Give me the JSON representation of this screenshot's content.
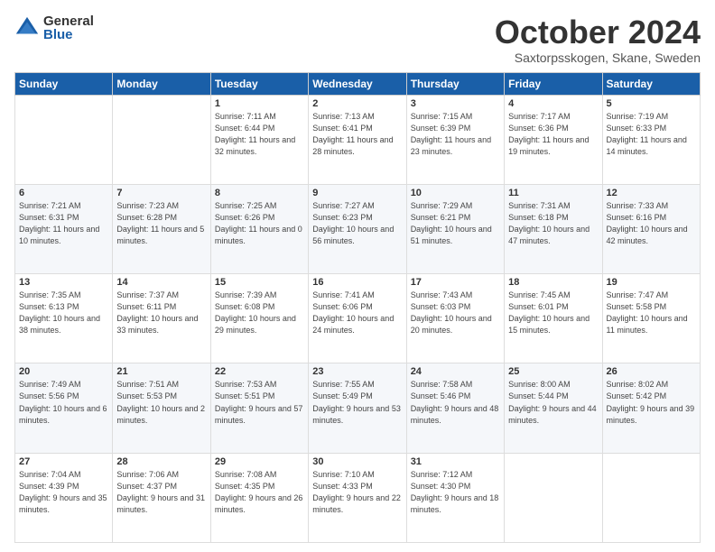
{
  "logo": {
    "general": "General",
    "blue": "Blue"
  },
  "header": {
    "month": "October 2024",
    "location": "Saxtorpsskogen, Skane, Sweden"
  },
  "days_of_week": [
    "Sunday",
    "Monday",
    "Tuesday",
    "Wednesday",
    "Thursday",
    "Friday",
    "Saturday"
  ],
  "weeks": [
    [
      {
        "day": "",
        "sunrise": "",
        "sunset": "",
        "daylight": ""
      },
      {
        "day": "",
        "sunrise": "",
        "sunset": "",
        "daylight": ""
      },
      {
        "day": "1",
        "sunrise": "Sunrise: 7:11 AM",
        "sunset": "Sunset: 6:44 PM",
        "daylight": "Daylight: 11 hours and 32 minutes."
      },
      {
        "day": "2",
        "sunrise": "Sunrise: 7:13 AM",
        "sunset": "Sunset: 6:41 PM",
        "daylight": "Daylight: 11 hours and 28 minutes."
      },
      {
        "day": "3",
        "sunrise": "Sunrise: 7:15 AM",
        "sunset": "Sunset: 6:39 PM",
        "daylight": "Daylight: 11 hours and 23 minutes."
      },
      {
        "day": "4",
        "sunrise": "Sunrise: 7:17 AM",
        "sunset": "Sunset: 6:36 PM",
        "daylight": "Daylight: 11 hours and 19 minutes."
      },
      {
        "day": "5",
        "sunrise": "Sunrise: 7:19 AM",
        "sunset": "Sunset: 6:33 PM",
        "daylight": "Daylight: 11 hours and 14 minutes."
      }
    ],
    [
      {
        "day": "6",
        "sunrise": "Sunrise: 7:21 AM",
        "sunset": "Sunset: 6:31 PM",
        "daylight": "Daylight: 11 hours and 10 minutes."
      },
      {
        "day": "7",
        "sunrise": "Sunrise: 7:23 AM",
        "sunset": "Sunset: 6:28 PM",
        "daylight": "Daylight: 11 hours and 5 minutes."
      },
      {
        "day": "8",
        "sunrise": "Sunrise: 7:25 AM",
        "sunset": "Sunset: 6:26 PM",
        "daylight": "Daylight: 11 hours and 0 minutes."
      },
      {
        "day": "9",
        "sunrise": "Sunrise: 7:27 AM",
        "sunset": "Sunset: 6:23 PM",
        "daylight": "Daylight: 10 hours and 56 minutes."
      },
      {
        "day": "10",
        "sunrise": "Sunrise: 7:29 AM",
        "sunset": "Sunset: 6:21 PM",
        "daylight": "Daylight: 10 hours and 51 minutes."
      },
      {
        "day": "11",
        "sunrise": "Sunrise: 7:31 AM",
        "sunset": "Sunset: 6:18 PM",
        "daylight": "Daylight: 10 hours and 47 minutes."
      },
      {
        "day": "12",
        "sunrise": "Sunrise: 7:33 AM",
        "sunset": "Sunset: 6:16 PM",
        "daylight": "Daylight: 10 hours and 42 minutes."
      }
    ],
    [
      {
        "day": "13",
        "sunrise": "Sunrise: 7:35 AM",
        "sunset": "Sunset: 6:13 PM",
        "daylight": "Daylight: 10 hours and 38 minutes."
      },
      {
        "day": "14",
        "sunrise": "Sunrise: 7:37 AM",
        "sunset": "Sunset: 6:11 PM",
        "daylight": "Daylight: 10 hours and 33 minutes."
      },
      {
        "day": "15",
        "sunrise": "Sunrise: 7:39 AM",
        "sunset": "Sunset: 6:08 PM",
        "daylight": "Daylight: 10 hours and 29 minutes."
      },
      {
        "day": "16",
        "sunrise": "Sunrise: 7:41 AM",
        "sunset": "Sunset: 6:06 PM",
        "daylight": "Daylight: 10 hours and 24 minutes."
      },
      {
        "day": "17",
        "sunrise": "Sunrise: 7:43 AM",
        "sunset": "Sunset: 6:03 PM",
        "daylight": "Daylight: 10 hours and 20 minutes."
      },
      {
        "day": "18",
        "sunrise": "Sunrise: 7:45 AM",
        "sunset": "Sunset: 6:01 PM",
        "daylight": "Daylight: 10 hours and 15 minutes."
      },
      {
        "day": "19",
        "sunrise": "Sunrise: 7:47 AM",
        "sunset": "Sunset: 5:58 PM",
        "daylight": "Daylight: 10 hours and 11 minutes."
      }
    ],
    [
      {
        "day": "20",
        "sunrise": "Sunrise: 7:49 AM",
        "sunset": "Sunset: 5:56 PM",
        "daylight": "Daylight: 10 hours and 6 minutes."
      },
      {
        "day": "21",
        "sunrise": "Sunrise: 7:51 AM",
        "sunset": "Sunset: 5:53 PM",
        "daylight": "Daylight: 10 hours and 2 minutes."
      },
      {
        "day": "22",
        "sunrise": "Sunrise: 7:53 AM",
        "sunset": "Sunset: 5:51 PM",
        "daylight": "Daylight: 9 hours and 57 minutes."
      },
      {
        "day": "23",
        "sunrise": "Sunrise: 7:55 AM",
        "sunset": "Sunset: 5:49 PM",
        "daylight": "Daylight: 9 hours and 53 minutes."
      },
      {
        "day": "24",
        "sunrise": "Sunrise: 7:58 AM",
        "sunset": "Sunset: 5:46 PM",
        "daylight": "Daylight: 9 hours and 48 minutes."
      },
      {
        "day": "25",
        "sunrise": "Sunrise: 8:00 AM",
        "sunset": "Sunset: 5:44 PM",
        "daylight": "Daylight: 9 hours and 44 minutes."
      },
      {
        "day": "26",
        "sunrise": "Sunrise: 8:02 AM",
        "sunset": "Sunset: 5:42 PM",
        "daylight": "Daylight: 9 hours and 39 minutes."
      }
    ],
    [
      {
        "day": "27",
        "sunrise": "Sunrise: 7:04 AM",
        "sunset": "Sunset: 4:39 PM",
        "daylight": "Daylight: 9 hours and 35 minutes."
      },
      {
        "day": "28",
        "sunrise": "Sunrise: 7:06 AM",
        "sunset": "Sunset: 4:37 PM",
        "daylight": "Daylight: 9 hours and 31 minutes."
      },
      {
        "day": "29",
        "sunrise": "Sunrise: 7:08 AM",
        "sunset": "Sunset: 4:35 PM",
        "daylight": "Daylight: 9 hours and 26 minutes."
      },
      {
        "day": "30",
        "sunrise": "Sunrise: 7:10 AM",
        "sunset": "Sunset: 4:33 PM",
        "daylight": "Daylight: 9 hours and 22 minutes."
      },
      {
        "day": "31",
        "sunrise": "Sunrise: 7:12 AM",
        "sunset": "Sunset: 4:30 PM",
        "daylight": "Daylight: 9 hours and 18 minutes."
      },
      {
        "day": "",
        "sunrise": "",
        "sunset": "",
        "daylight": ""
      },
      {
        "day": "",
        "sunrise": "",
        "sunset": "",
        "daylight": ""
      }
    ]
  ]
}
